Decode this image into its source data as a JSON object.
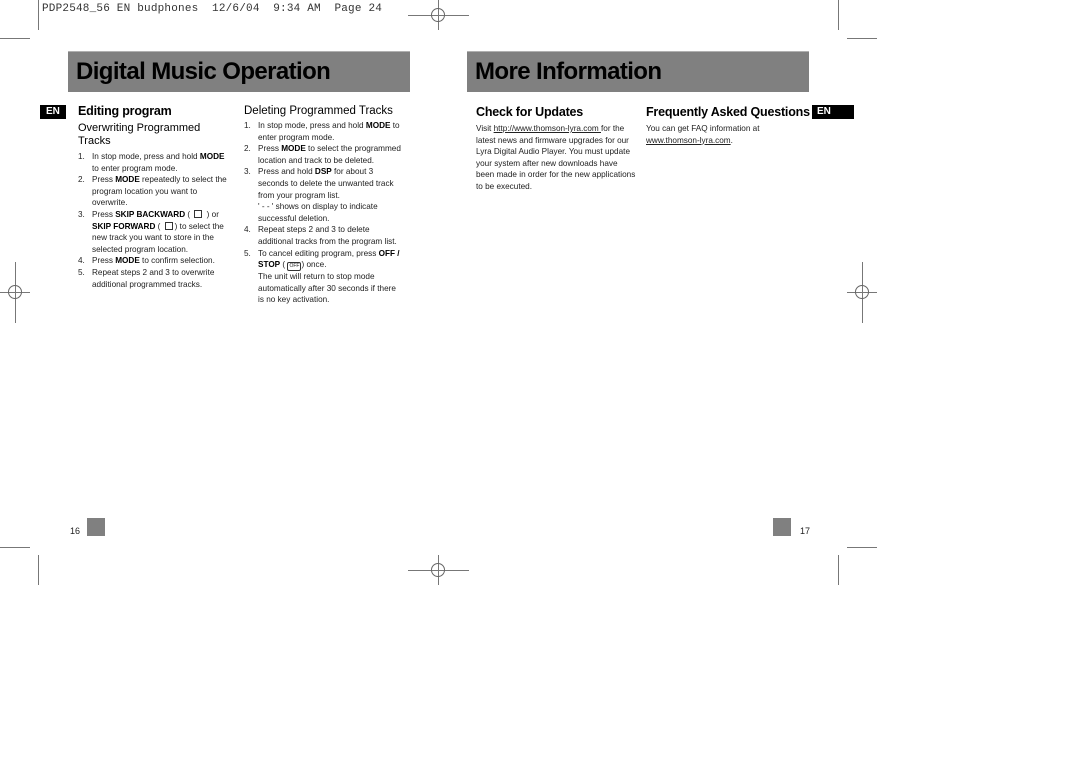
{
  "slug": "PDP2548_56 EN budphones  12/6/04  9:34 AM  Page 24",
  "left_page": {
    "banner_title": "Digital Music Operation",
    "lang_badge": "EN",
    "section_title": "Editing program",
    "overwriting": {
      "title": "Overwriting Programmed Tracks",
      "steps": [
        {
          "num": "1.",
          "pre": " In stop mode, press and hold ",
          "bold": "MODE",
          "post": " to enter program mode."
        },
        {
          "num": "2.",
          "pre": "Press ",
          "bold": "MODE",
          "post": " repeatedly to select the program location you want to overwrite."
        },
        {
          "num": "3.",
          "pre": "Press ",
          "bold": "SKIP BACKWARD",
          "mid": " ( ",
          "icon1": "skip-backward-icon",
          "mid2": " ) or ",
          "bold2": "SKIP FORWARD",
          "mid3": " ( ",
          "icon2": "skip-forward-icon",
          "post": ") to select the new track you want to store in the selected program location."
        },
        {
          "num": "4.",
          "pre": "Press ",
          "bold": "MODE",
          "post": " to confirm selection."
        },
        {
          "num": "5.",
          "pre": "Repeat steps 2 and 3 to overwrite additional programmed tracks.",
          "bold": "",
          "post": ""
        }
      ]
    },
    "deleting": {
      "title": "Deleting Programmed Tracks",
      "steps": [
        {
          "num": "1.",
          "pre": "In stop mode, press and hold ",
          "bold": "MODE",
          "post": " to enter program mode."
        },
        {
          "num": "2.",
          "pre": "Press ",
          "bold": "MODE",
          "post": " to select the programmed location and track to be deleted."
        },
        {
          "num": "3.",
          "pre": "Press and hold ",
          "bold": "DSP",
          "post": " for about 3 seconds  to delete the unwanted track from your program list.",
          "note": "' - - ' shows on display to indicate successful deletion."
        },
        {
          "num": "4.",
          "pre": "Repeat steps 2 and 3 to delete additional tracks from the program list.",
          "bold": "",
          "post": ""
        },
        {
          "num": "5.",
          "pre": "To cancel editing program, press ",
          "bold": "OFF / STOP",
          "mid": " ( ",
          "icon1": "off-button-icon",
          "icon_text": "OFF",
          "post": ") once.",
          "note": "The unit will return to stop mode automatically after 30 seconds if there is no key activation."
        }
      ]
    },
    "page_number": "16"
  },
  "right_page": {
    "banner_title": "More Information",
    "lang_badge": "EN",
    "updates": {
      "title": "Check for Updates",
      "pre": "Visit  ",
      "link": "http://www.thomson-lyra.com ",
      "post": "for the latest news and firmware upgrades for our Lyra Digital Audio Player. You must update your system after new downloads have been made in order for the new applications to be executed."
    },
    "faq": {
      "title": "Frequently Asked Questions",
      "pre": "You can get FAQ information at ",
      "link": "www.thomson-lyra.com",
      "post": "."
    },
    "page_number": "17"
  }
}
